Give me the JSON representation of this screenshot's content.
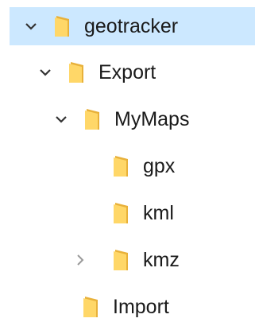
{
  "colors": {
    "selection": "#cce8ff",
    "folder_front": "#ffd768",
    "folder_back": "#e8b13a",
    "text": "#1a1a1a",
    "chevron_expanded": "#333333",
    "chevron_collapsed": "#9a9a9a"
  },
  "tree": {
    "items": [
      {
        "label": "geotracker",
        "state": "expanded",
        "icon": "folder-icon",
        "selected": true
      },
      {
        "label": "Export",
        "state": "expanded",
        "icon": "folder-icon",
        "selected": false
      },
      {
        "label": "MyMaps",
        "state": "expanded",
        "icon": "folder-icon",
        "selected": false
      },
      {
        "label": "gpx",
        "state": "none",
        "icon": "folder-icon",
        "selected": false
      },
      {
        "label": "kml",
        "state": "none",
        "icon": "folder-icon",
        "selected": false
      },
      {
        "label": "kmz",
        "state": "collapsed",
        "icon": "folder-icon",
        "selected": false
      },
      {
        "label": "Import",
        "state": "none",
        "icon": "folder-icon",
        "selected": false
      }
    ]
  }
}
